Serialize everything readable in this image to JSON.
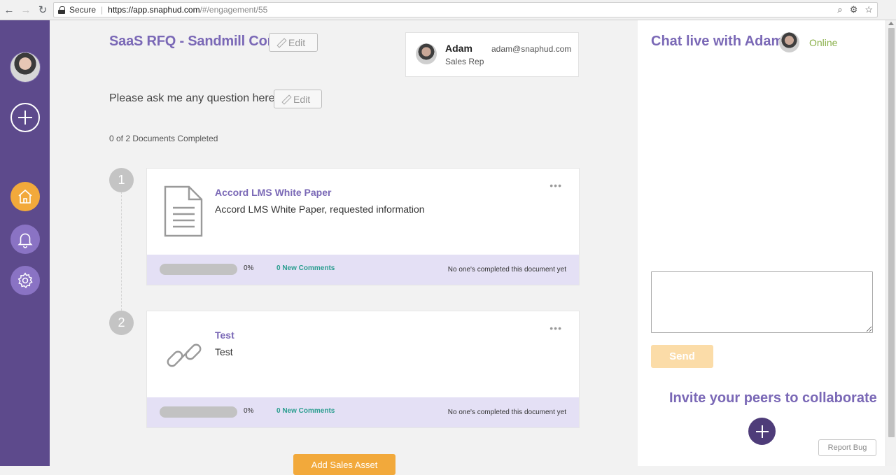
{
  "browser": {
    "secure_label": "Secure",
    "url_host": "https://app.snaphud.com",
    "url_path": "/#/engagement/55"
  },
  "left_rail": {
    "items": [
      {
        "name": "home",
        "icon": "home-icon",
        "color": "#f2a93b"
      },
      {
        "name": "notifications",
        "icon": "bell-icon",
        "color": "#8a73c4"
      },
      {
        "name": "settings",
        "icon": "gear-icon",
        "color": "#8a73c4"
      }
    ]
  },
  "engagement": {
    "title": "SaaS RFQ - Sandmill Corp",
    "edit_label": "Edit",
    "question": "Please ask me any question here.",
    "docs_completed": "0 of 2 Documents Completed"
  },
  "rep": {
    "name": "Adam",
    "role": "Sales Rep",
    "email": "adam@snaphud.com"
  },
  "documents": [
    {
      "step": "1",
      "title": "Accord LMS White Paper",
      "description": "Accord LMS White Paper, requested information",
      "icon": "document-icon",
      "progress_pct": "0%",
      "progress": 0,
      "comments": "0 New Comments",
      "status": "No one's completed this document yet"
    },
    {
      "step": "2",
      "title": "Test",
      "description": "Test",
      "icon": "link-icon",
      "progress_pct": "0%",
      "progress": 0,
      "comments": "0 New Comments",
      "status": "No one's completed this document yet"
    }
  ],
  "add_asset_label": "Add Sales Asset",
  "chat": {
    "title": "Chat live with Adam",
    "status": "Online",
    "send_label": "Send",
    "invite_title": "Invite your peers to collaborate",
    "report_bug_label": "Report Bug"
  },
  "colors": {
    "brand_purple": "#7a68b6",
    "rail": "#5d4a8c",
    "accent_orange": "#f2a93b",
    "online_green": "#8ab04a"
  }
}
